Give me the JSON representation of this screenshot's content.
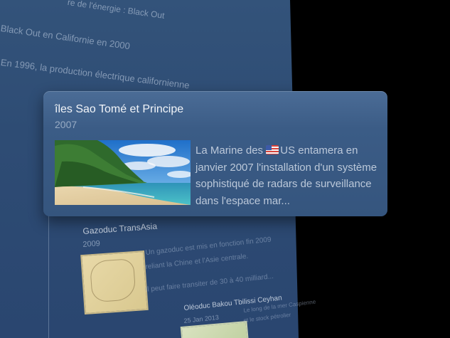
{
  "background": {
    "line1": "re de l'énergie : Black Out",
    "line2": "Black Out en Californie en 2000",
    "line3": "En 1996, la production électrique californienne",
    "item1": {
      "title": "Gazoduc TransAsia",
      "year": "2009",
      "desc1": "Un gazoduc est mis en fonction fin 2009",
      "desc2": "reliant la Chine et l'Asie centrale.",
      "desc3": "Il peut faire transiter de 30 à 40 milliard..."
    },
    "item2": {
      "title": "Oléoduc Bakou Tbilissi Ceyhan",
      "year": "25 Jan 2013",
      "desc1": "Le long de la mer Caspienne",
      "desc2": "et le stock pétrolier"
    }
  },
  "card": {
    "title": "îles Sao Tomé et Principe",
    "year": "2007",
    "text_before_flag": "La Marine des ",
    "flag_icon": "us-flag-icon",
    "text_after_flag": "US entamera en janvier 2007 l'installation d'un système sophistiqué de radars de surveillance dans l'espace mar..."
  },
  "colors": {
    "card_bg": "#3b5c86",
    "panel_bg": "#2e4c74",
    "page_bg": "#000000"
  }
}
